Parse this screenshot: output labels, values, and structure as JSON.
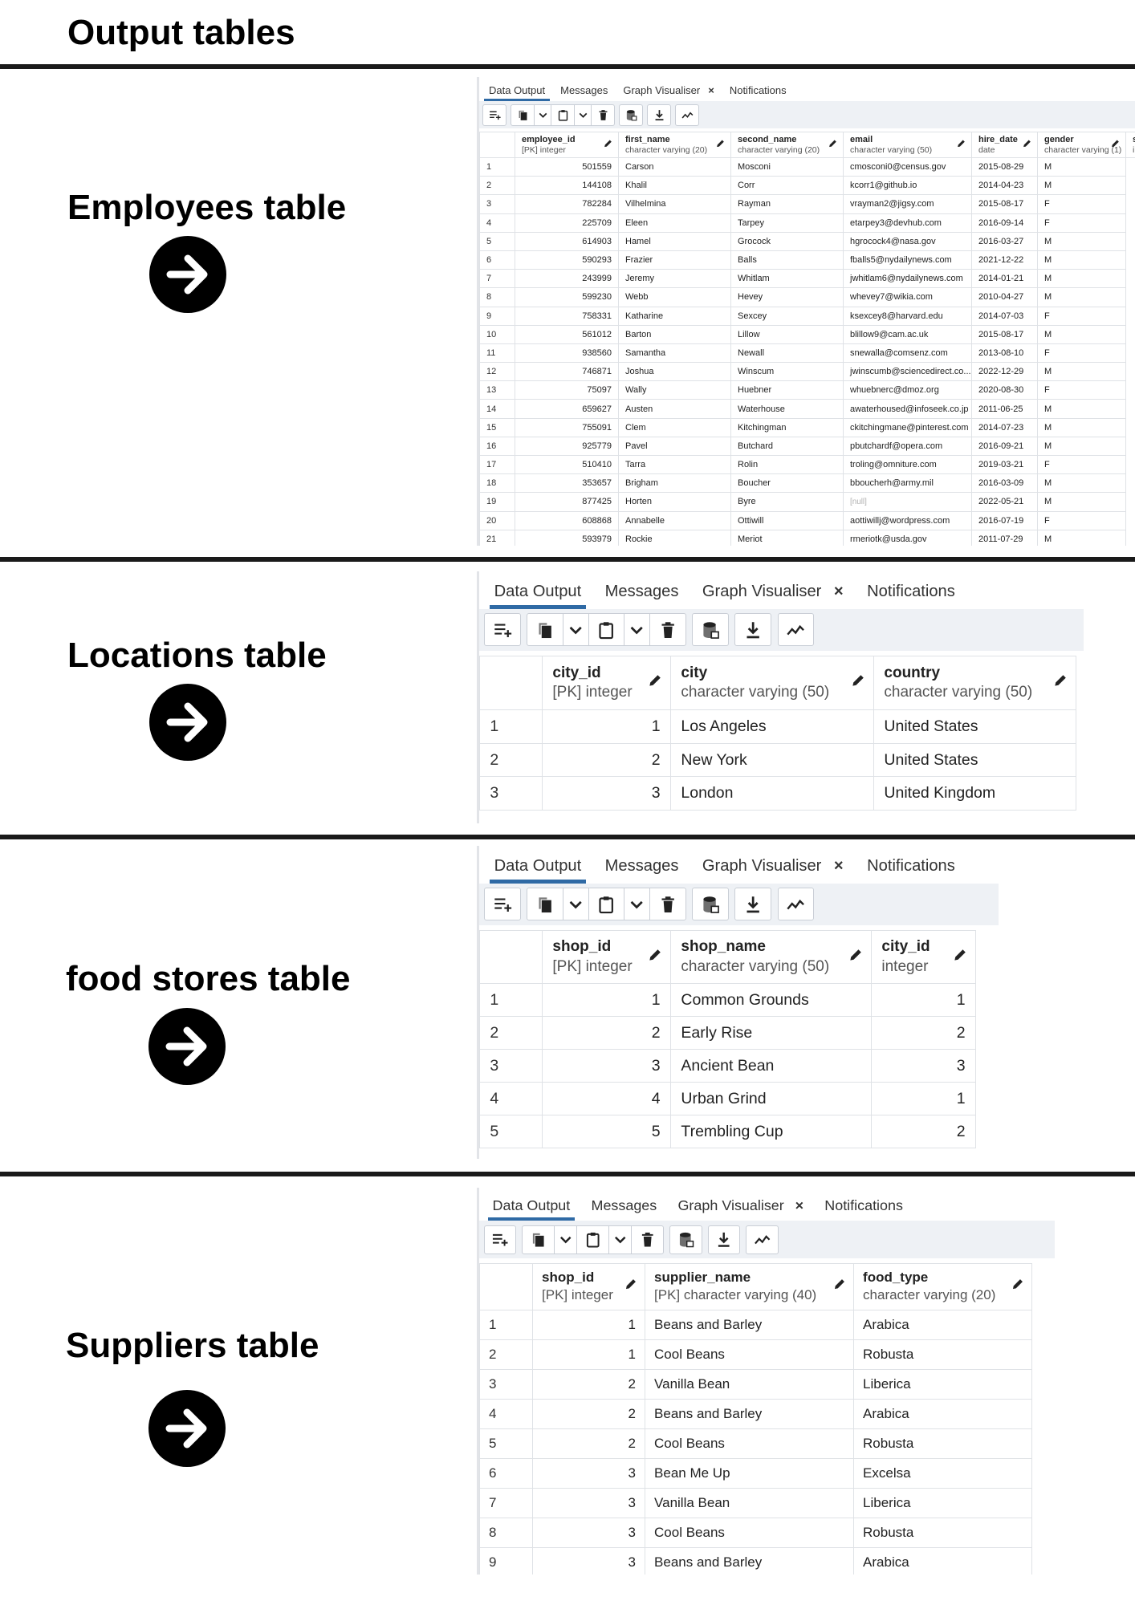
{
  "page": {
    "title": "Output tables"
  },
  "tabs": {
    "data_output": "Data Output",
    "messages": "Messages",
    "graph_visualiser": "Graph Visualiser",
    "close": "×",
    "notifications": "Notifications"
  },
  "employees": {
    "title": "Employees table",
    "columns": [
      {
        "name": "employee_id",
        "type": "[PK] integer"
      },
      {
        "name": "first_name",
        "type": "character varying (20)"
      },
      {
        "name": "second_name",
        "type": "character varying (20)"
      },
      {
        "name": "email",
        "type": "character varying (50)"
      },
      {
        "name": "hire_date",
        "type": "date"
      },
      {
        "name": "gender",
        "type": "character varying (1)"
      },
      {
        "name": "sa",
        "type": "in"
      }
    ],
    "rows": [
      [
        "1",
        "501559",
        "Carson",
        "Mosconi",
        "cmosconi0@census.gov",
        "2015-08-29",
        "M"
      ],
      [
        "2",
        "144108",
        "Khalil",
        "Corr",
        "kcorr1@github.io",
        "2014-04-23",
        "M"
      ],
      [
        "3",
        "782284",
        "Vilhelmina",
        "Rayman",
        "vrayman2@jigsy.com",
        "2015-08-17",
        "F"
      ],
      [
        "4",
        "225709",
        "Eleen",
        "Tarpey",
        "etarpey3@devhub.com",
        "2016-09-14",
        "F"
      ],
      [
        "5",
        "614903",
        "Hamel",
        "Grocock",
        "hgrocock4@nasa.gov",
        "2016-03-27",
        "M"
      ],
      [
        "6",
        "590293",
        "Frazier",
        "Balls",
        "fballs5@nydailynews.com",
        "2021-12-22",
        "M"
      ],
      [
        "7",
        "243999",
        "Jeremy",
        "Whitlam",
        "jwhitlam6@nydailynews.com",
        "2014-01-21",
        "M"
      ],
      [
        "8",
        "599230",
        "Webb",
        "Hevey",
        "whevey7@wikia.com",
        "2010-04-27",
        "M"
      ],
      [
        "9",
        "758331",
        "Katharine",
        "Sexcey",
        "ksexcey8@harvard.edu",
        "2014-07-03",
        "F"
      ],
      [
        "10",
        "561012",
        "Barton",
        "Lillow",
        "blillow9@cam.ac.uk",
        "2015-08-17",
        "M"
      ],
      [
        "11",
        "938560",
        "Samantha",
        "Newall",
        "snewalla@comsenz.com",
        "2013-08-10",
        "F"
      ],
      [
        "12",
        "746871",
        "Joshua",
        "Winscum",
        "jwinscumb@sciencedirect.co...",
        "2022-12-29",
        "M"
      ],
      [
        "13",
        "75097",
        "Wally",
        "Huebner",
        "whuebnerc@dmoz.org",
        "2020-08-30",
        "F"
      ],
      [
        "14",
        "659627",
        "Austen",
        "Waterhouse",
        "awaterhoused@infoseek.co.jp",
        "2011-06-25",
        "M"
      ],
      [
        "15",
        "755091",
        "Clem",
        "Kitchingman",
        "ckitchingmane@pinterest.com",
        "2014-07-23",
        "M"
      ],
      [
        "16",
        "925779",
        "Pavel",
        "Butchard",
        "pbutchardf@opera.com",
        "2016-09-21",
        "M"
      ],
      [
        "17",
        "510410",
        "Tarra",
        "Rolin",
        "troling@omniture.com",
        "2019-03-21",
        "F"
      ],
      [
        "18",
        "353657",
        "Brigham",
        "Boucher",
        "bboucherh@army.mil",
        "2016-03-09",
        "M"
      ],
      [
        "19",
        "877425",
        "Horten",
        "Byre",
        "[null]",
        "2022-05-21",
        "M"
      ],
      [
        "20",
        "608868",
        "Annabelle",
        "Ottiwill",
        "aottiwillj@wordpress.com",
        "2016-07-19",
        "F"
      ],
      [
        "21",
        "593979",
        "Rockie",
        "Meriot",
        "rmeriotk@usda.gov",
        "2011-07-29",
        "M"
      ]
    ]
  },
  "locations": {
    "title": "Locations table",
    "columns": [
      {
        "name": "city_id",
        "type": "[PK] integer"
      },
      {
        "name": "city",
        "type": "character varying (50)"
      },
      {
        "name": "country",
        "type": "character varying (50)"
      }
    ],
    "rows": [
      [
        "1",
        "1",
        "Los Angeles",
        "United States"
      ],
      [
        "2",
        "2",
        "New York",
        "United States"
      ],
      [
        "3",
        "3",
        "London",
        "United Kingdom"
      ]
    ]
  },
  "stores": {
    "title": "food stores table",
    "columns": [
      {
        "name": "shop_id",
        "type": "[PK] integer"
      },
      {
        "name": "shop_name",
        "type": "character varying (50)"
      },
      {
        "name": "city_id",
        "type": "integer"
      }
    ],
    "rows": [
      [
        "1",
        "1",
        "Common Grounds",
        "1"
      ],
      [
        "2",
        "2",
        "Early Rise",
        "2"
      ],
      [
        "3",
        "3",
        "Ancient Bean",
        "3"
      ],
      [
        "4",
        "4",
        "Urban Grind",
        "1"
      ],
      [
        "5",
        "5",
        "Trembling Cup",
        "2"
      ]
    ]
  },
  "suppliers": {
    "title": "Suppliers table",
    "columns": [
      {
        "name": "shop_id",
        "type": "[PK] integer"
      },
      {
        "name": "supplier_name",
        "type": "[PK] character varying (40)"
      },
      {
        "name": "food_type",
        "type": "character varying (20)"
      }
    ],
    "rows": [
      [
        "1",
        "1",
        "Beans and Barley",
        "Arabica"
      ],
      [
        "2",
        "1",
        "Cool Beans",
        "Robusta"
      ],
      [
        "3",
        "2",
        "Vanilla Bean",
        "Liberica"
      ],
      [
        "4",
        "2",
        "Beans and Barley",
        "Arabica"
      ],
      [
        "5",
        "2",
        "Cool Beans",
        "Robusta"
      ],
      [
        "6",
        "3",
        "Bean Me Up",
        "Excelsa"
      ],
      [
        "7",
        "3",
        "Vanilla Bean",
        "Liberica"
      ],
      [
        "8",
        "3",
        "Cool Beans",
        "Robusta"
      ],
      [
        "9",
        "3",
        "Beans and Barley",
        "Arabica"
      ]
    ]
  }
}
